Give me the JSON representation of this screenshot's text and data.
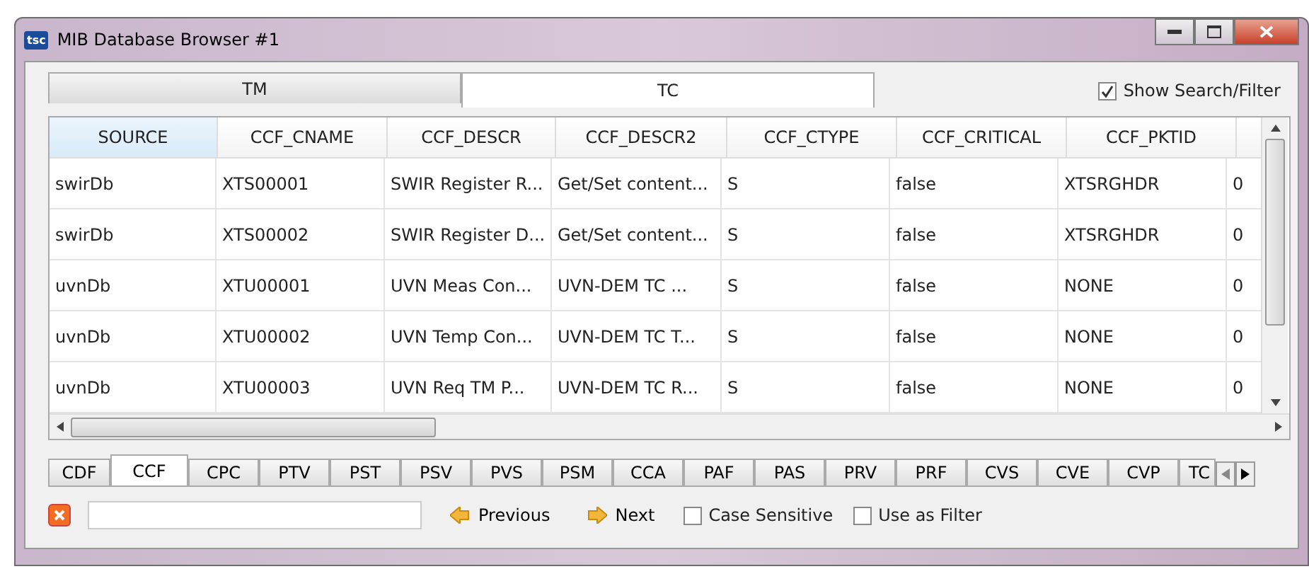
{
  "window": {
    "title": "MIB Database Browser #1",
    "icon": "tsc"
  },
  "top_tabs": [
    {
      "label": "TM",
      "selected": false
    },
    {
      "label": "TC",
      "selected": true
    }
  ],
  "show_search_filter": {
    "label": "Show Search/Filter",
    "checked": true
  },
  "table": {
    "columns": [
      "SOURCE",
      "CCF_CNAME",
      "CCF_DESCR",
      "CCF_DESCR2",
      "CCF_CTYPE",
      "CCF_CRITICAL",
      "CCF_PKTID"
    ],
    "rows": [
      [
        "swirDb",
        "XTS00001",
        "SWIR Register R...",
        "Get/Set content...",
        "S",
        "false",
        "XTSRGHDR",
        "0"
      ],
      [
        "swirDb",
        "XTS00002",
        "SWIR Register D...",
        "Get/Set content...",
        "S",
        "false",
        "XTSRGHDR",
        "0"
      ],
      [
        "uvnDb",
        "XTU00001",
        "UVN Meas Con...",
        "UVN-DEM TC ...",
        "S",
        "false",
        "NONE",
        "0"
      ],
      [
        "uvnDb",
        "XTU00002",
        "UVN Temp Con...",
        "UVN-DEM TC T...",
        "S",
        "false",
        "NONE",
        "0"
      ],
      [
        "uvnDb",
        "XTU00003",
        "UVN Req TM P...",
        "UVN-DEM TC R...",
        "S",
        "false",
        "NONE",
        "0"
      ]
    ]
  },
  "bottom_tabs": [
    {
      "label": "CDF",
      "selected": false
    },
    {
      "label": "CCF",
      "selected": true
    },
    {
      "label": "CPC",
      "selected": false
    },
    {
      "label": "PTV",
      "selected": false
    },
    {
      "label": "PST",
      "selected": false
    },
    {
      "label": "PSV",
      "selected": false
    },
    {
      "label": "PVS",
      "selected": false
    },
    {
      "label": "PSM",
      "selected": false
    },
    {
      "label": "CCA",
      "selected": false
    },
    {
      "label": "PAF",
      "selected": false
    },
    {
      "label": "PAS",
      "selected": false
    },
    {
      "label": "PRV",
      "selected": false
    },
    {
      "label": "PRF",
      "selected": false
    },
    {
      "label": "CVS",
      "selected": false
    },
    {
      "label": "CVE",
      "selected": false
    },
    {
      "label": "CVP",
      "selected": false
    },
    {
      "label": "TC",
      "selected": false
    }
  ],
  "search": {
    "previous": "Previous",
    "next": "Next",
    "case_sensitive": {
      "label": "Case Sensitive",
      "checked": false
    },
    "use_as_filter": {
      "label": "Use as Filter",
      "checked": false
    }
  }
}
